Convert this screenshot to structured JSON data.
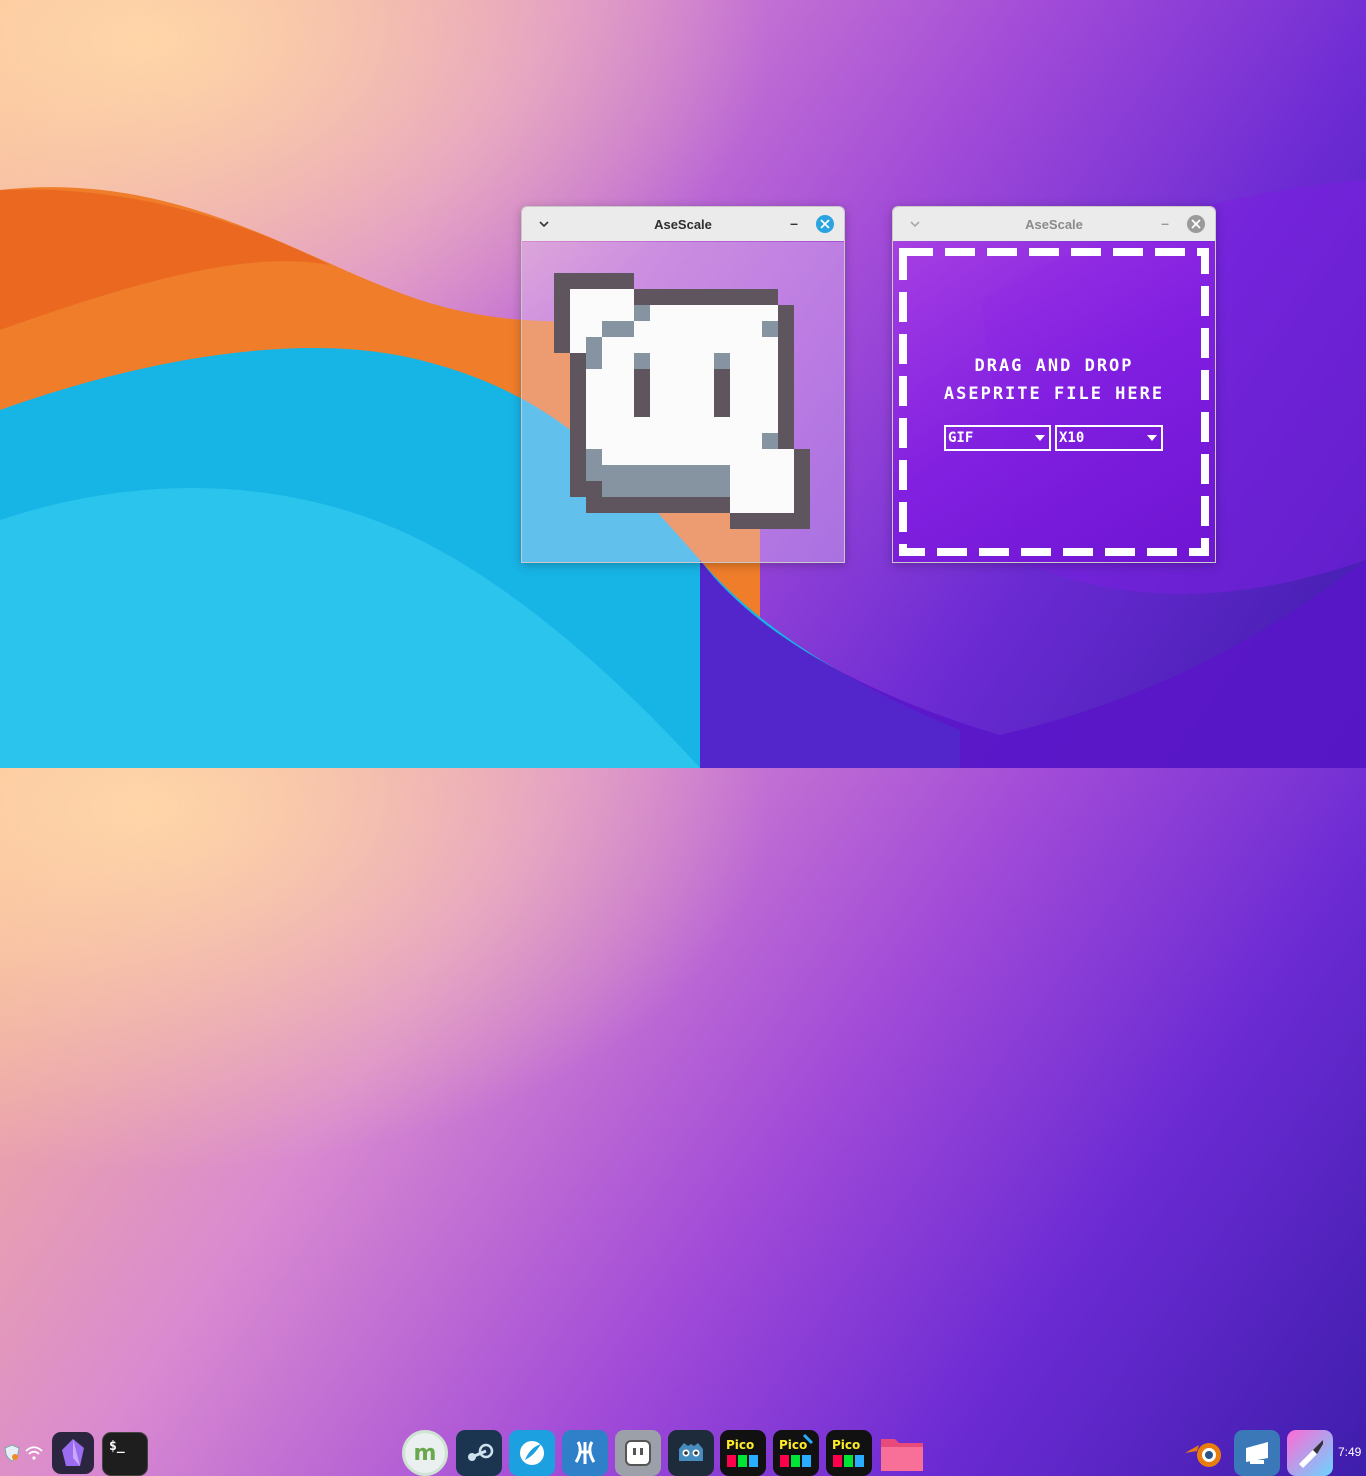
{
  "window_left": {
    "title": "AseScale",
    "minimize_label": "–"
  },
  "window_right": {
    "title": "AseScale",
    "minimize_label": "–",
    "drop_text_line1": "DRAG AND DROP",
    "drop_text_line2": "ASEPRITE FILE HERE",
    "format_select": {
      "value": "GIF"
    },
    "scale_select": {
      "value": "X10"
    }
  },
  "taskbar": {
    "clock": "7:49",
    "apps": [
      "linux-mint-menu-icon",
      "steam-icon",
      "surfing-app-icon",
      "vscodium-icon",
      "itch-io-icon",
      "godot-icon",
      "pico-8-icon",
      "pico-8-editor-icon",
      "pico-8-alt-icon",
      "files-folder-icon"
    ],
    "left_apps": [
      "obsidian-icon",
      "terminal-icon"
    ],
    "right_apps": [
      "blender-icon",
      "desktop-tool-icon",
      "paint-brush-icon"
    ],
    "terminal_label": "$_"
  },
  "colors": {
    "accent_close": "#2aa3e0",
    "drop_zone_purple": "#8a2be2",
    "sprite_dark": "#5e555f",
    "sprite_shade": "#8594a0"
  }
}
